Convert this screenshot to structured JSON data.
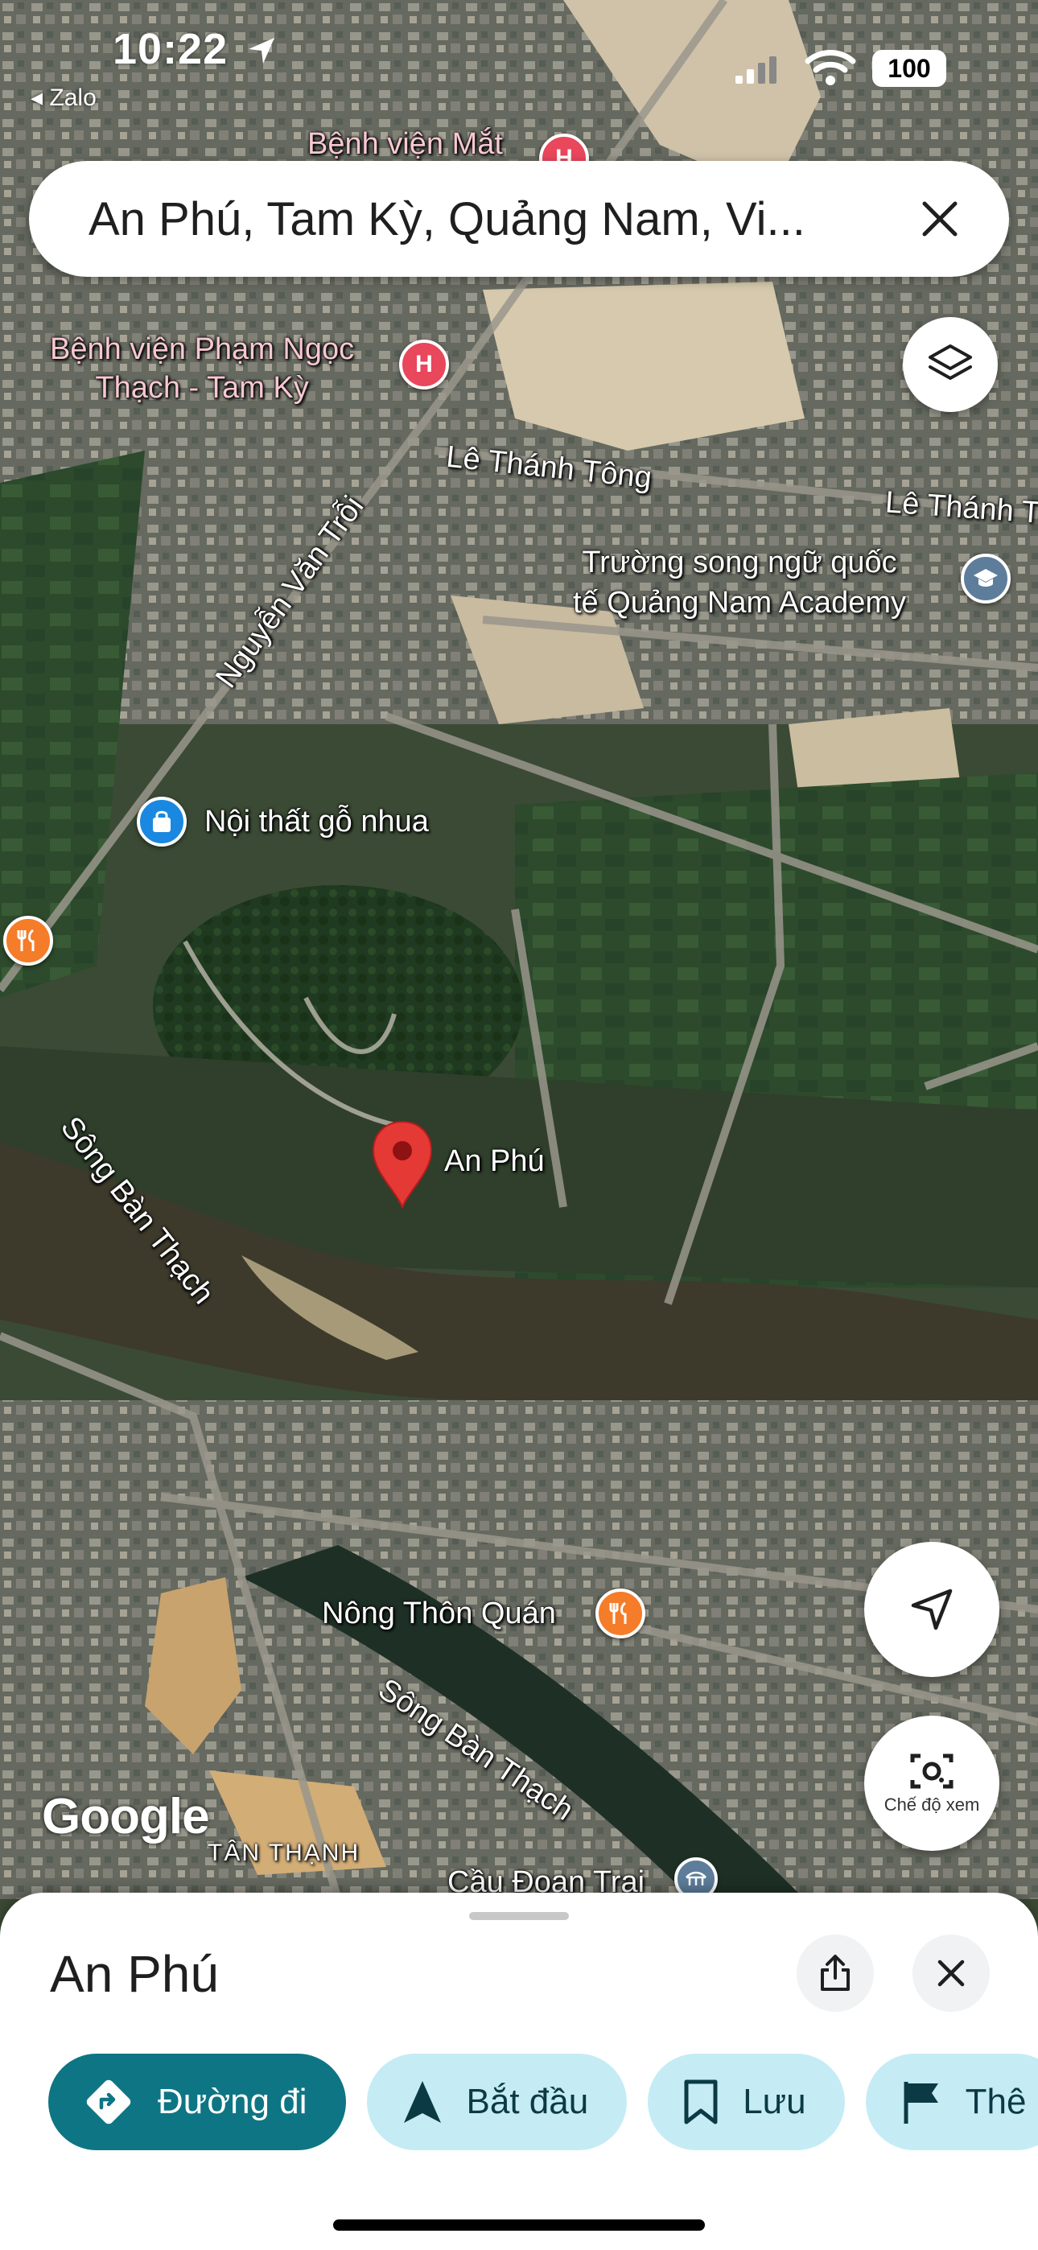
{
  "status_bar": {
    "time": "10:22",
    "back_app": "◂ Zalo",
    "battery": "100"
  },
  "search": {
    "query": "An Phú, Tam Kỳ, Quảng Nam, Vi..."
  },
  "map": {
    "labels": {
      "hospital_mat": "Bệnh viện Mắt",
      "hospital_pnt": "Bệnh viện Phạm Ngọc\nThạch - Tam Kỳ",
      "road_le_thanh_tong_1": "Lê Thánh Tông",
      "road_le_thanh_tong_2": "Lê Thánh T",
      "school": "Trường song ngữ quốc\ntế Quảng Nam Academy",
      "road_nguyen_van_troi": "Nguyễn Văn Trỗi",
      "store": "Nội thất gỗ nhua",
      "river_1": "Sông Bàn Thạch",
      "pin_label": "An Phú",
      "restaurant": "Nông Thôn Quán",
      "river_2": "Sông Bàn Thạch",
      "district": "TÂN THẠNH",
      "bridge": "Cầu Đoan Trai"
    },
    "attribution": "Google",
    "colors": {
      "pin": "#e53935",
      "poi_medical": "#e8475c",
      "poi_food": "#f57c28",
      "poi_shop": "#1a88e0",
      "poi_school": "#5d7d9b"
    }
  },
  "controls": {
    "layers_icon": "layers-icon",
    "locate_icon": "navigation-arrow-icon",
    "lens_label": "Chế độ xem"
  },
  "sheet": {
    "title": "An Phú",
    "chips": [
      {
        "label": "Đường đi",
        "icon": "directions-icon"
      },
      {
        "label": "Bắt đầu",
        "icon": "navigation-icon"
      },
      {
        "label": "Lưu",
        "icon": "bookmark-icon"
      },
      {
        "label": "Thê",
        "icon": "flag-icon"
      }
    ]
  }
}
